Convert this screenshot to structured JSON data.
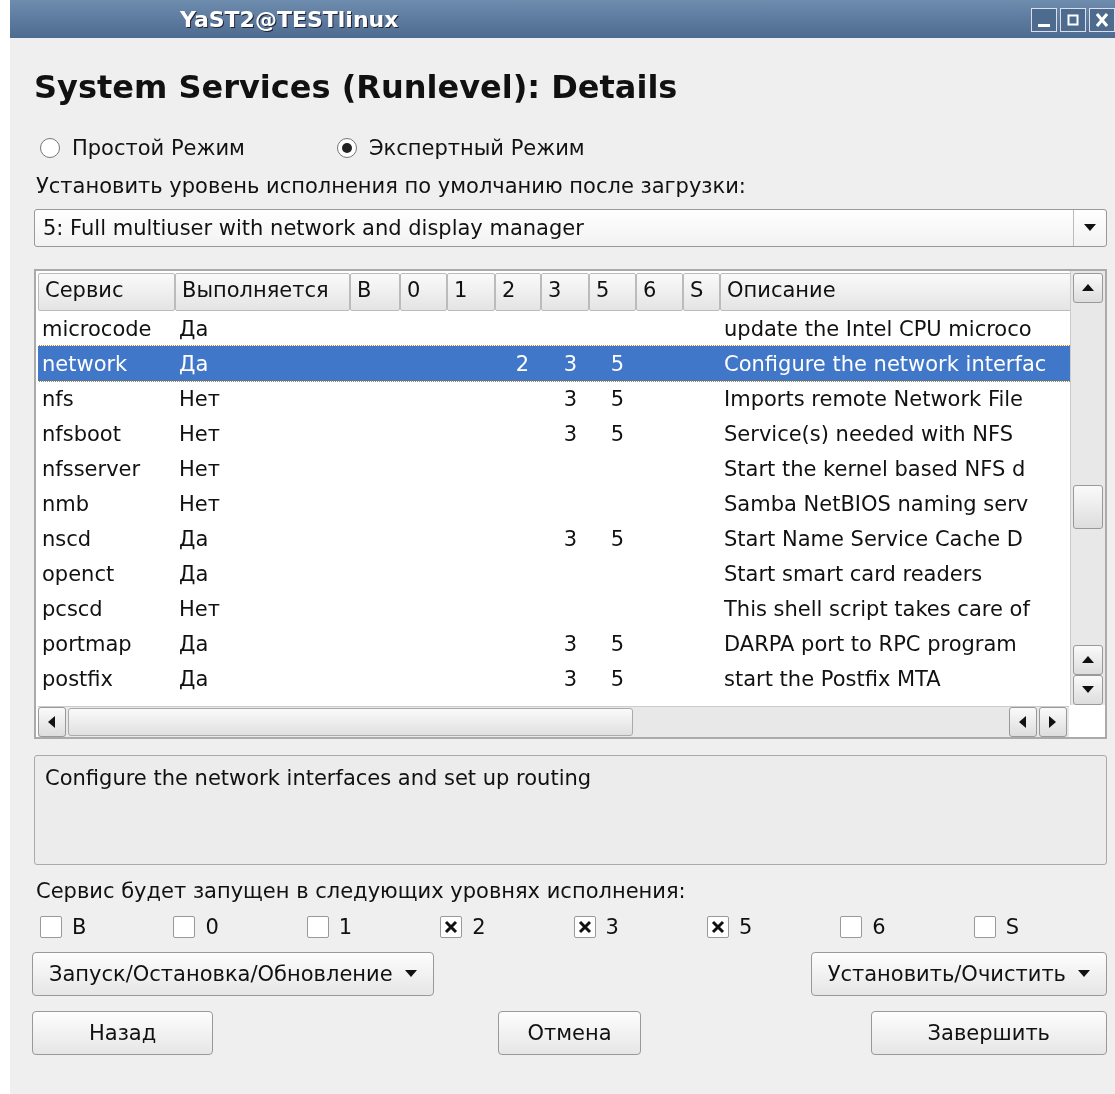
{
  "window": {
    "title": "YaST2@TESTlinux"
  },
  "heading": "System Services (Runlevel): Details",
  "modes": [
    {
      "label": "Простой Режим",
      "selected": false
    },
    {
      "label": "Экспертный Режим",
      "selected": true
    }
  ],
  "default_runlevel": {
    "label": "Установить уровень исполнения по умолчанию после загрузки:",
    "value": "5: Full multiuser with network and display manager"
  },
  "table": {
    "columns": [
      "Сервис",
      "Выполняется",
      "B",
      "0",
      "1",
      "2",
      "3",
      "5",
      "6",
      "S",
      "Описание"
    ],
    "rows": [
      {
        "selected": false,
        "service": "microcode",
        "running": "Да",
        "description": "update the Intel CPU microco"
      },
      {
        "selected": true,
        "service": "network",
        "running": "Да",
        "level_2": "2",
        "level_3": "3",
        "level_5": "5",
        "description": "Configure the network interfac"
      },
      {
        "selected": false,
        "service": "nfs",
        "running": "Нет",
        "level_3": "3",
        "level_5": "5",
        "description": "Imports remote Network File"
      },
      {
        "selected": false,
        "service": "nfsboot",
        "running": "Нет",
        "level_3": "3",
        "level_5": "5",
        "description": "Service(s) needed with NFS"
      },
      {
        "selected": false,
        "service": "nfsserver",
        "running": "Нет",
        "description": "Start the kernel based NFS d"
      },
      {
        "selected": false,
        "service": "nmb",
        "running": "Нет",
        "description": "Samba NetBIOS naming serv"
      },
      {
        "selected": false,
        "service": "nscd",
        "running": "Да",
        "level_3": "3",
        "level_5": "5",
        "description": "Start Name Service Cache D"
      },
      {
        "selected": false,
        "service": "openct",
        "running": "Да",
        "description": "Start smart card readers"
      },
      {
        "selected": false,
        "service": "pcscd",
        "running": "Нет",
        "description": "This shell script takes care of"
      },
      {
        "selected": false,
        "service": "portmap",
        "running": "Да",
        "level_3": "3",
        "level_5": "5",
        "description": "DARPA port to RPC program"
      },
      {
        "selected": false,
        "service": "postfix",
        "running": "Да",
        "level_3": "3",
        "level_5": "5",
        "description": "start the Postfix MTA"
      }
    ]
  },
  "description_box": "Configure the network interfaces and set up routing",
  "levels_label": "Сервис будет запущен в следующих уровнях исполнения:",
  "levels": [
    {
      "label": "B",
      "checked": false
    },
    {
      "label": "0",
      "checked": false
    },
    {
      "label": "1",
      "checked": false
    },
    {
      "label": "2",
      "checked": true
    },
    {
      "label": "3",
      "checked": true
    },
    {
      "label": "5",
      "checked": true
    },
    {
      "label": "6",
      "checked": false
    },
    {
      "label": "S",
      "checked": false
    }
  ],
  "action_buttons": [
    "Запуск/Остановка/Обновление",
    "Установить/Очистить"
  ],
  "nav_buttons": [
    "Назад",
    "Отмена",
    "Завершить"
  ]
}
